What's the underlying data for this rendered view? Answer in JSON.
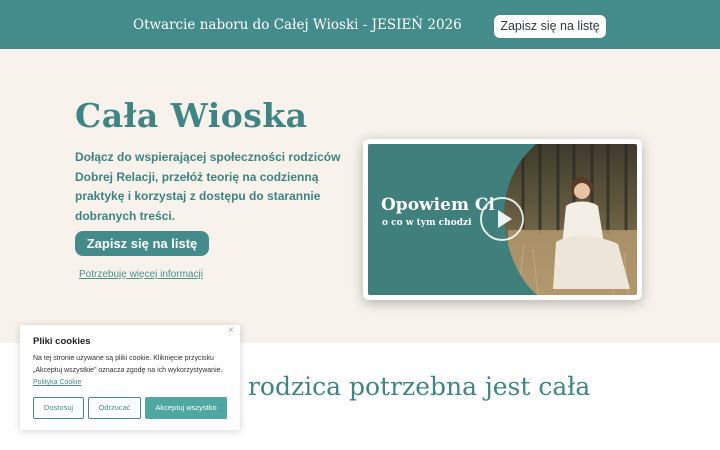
{
  "topbar": {
    "announcement": "Otwarcie naboru do Całej Wioski - JESIEŃ 2026",
    "button_label": "Zapisz się na listę"
  },
  "hero": {
    "title": "Cała Wioska",
    "description": "Dołącz do wspierającej społeczności rodziców Dobrej Relacji, przełóż teorię na codzienną praktykę i korzystaj z dostępu do starannie dobranych treści.",
    "cta_label": "Zapisz się na listę",
    "info_link": "Potrzebuję więcej informacji"
  },
  "video": {
    "title": "Opowiem Ci",
    "subtitle": "o co w tym chodzi",
    "play_icon": "play-icon"
  },
  "section2": {
    "heading": "ć rodzica potrzebna jest cała"
  },
  "cookie": {
    "title": "Pliki cookies",
    "text": "Na tej stronie używane są pliki cookie. Kliknięcie przycisku „Akceptuj wszystkie” oznacza zgodę na ich wykorzystywanie.",
    "policy_link": "Polityka Cookie",
    "close_icon": "×",
    "buttons": {
      "customize": "Dostosuj",
      "reject": "Odrzucać",
      "accept": "Akceptuj wszystko"
    }
  },
  "colors": {
    "brand_teal": "#448c8b",
    "hero_bg": "#f7f3ec",
    "accept_button": "#4ea7a0"
  }
}
